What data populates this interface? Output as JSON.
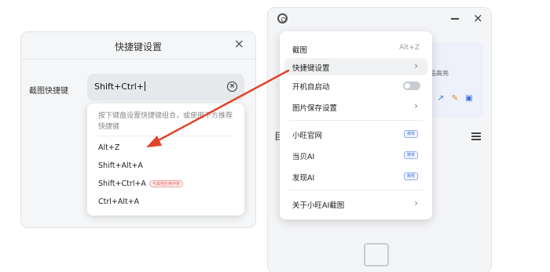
{
  "dialog": {
    "title": "快捷键设置",
    "close_glyph": "×",
    "field_label": "截图快捷键",
    "input_value": "Shift+Ctrl+",
    "dropdown": {
      "hint": "按下键盘设置快捷键组合，或使用下方推荐快捷键",
      "options": [
        {
          "label": "Alt+Z",
          "tag": ""
        },
        {
          "label": "Shift+Alt+A",
          "tag": ""
        },
        {
          "label": "Shift+Ctrl+A",
          "tag": "与其他应用冲突"
        },
        {
          "label": "Ctrl+Alt+A",
          "tag": ""
        }
      ]
    }
  },
  "panel": {
    "close_glyph": "×",
    "background_text": "品高亮",
    "background_left_glyph": "目"
  },
  "menu": {
    "items": [
      {
        "label": "截图",
        "shortcut": "Alt+Z"
      },
      {
        "label": "快捷键设置",
        "chevron": "›"
      },
      {
        "label": "开机自启动",
        "toggle_on": false
      },
      {
        "label": "图片保存设置",
        "chevron": "›"
      },
      {
        "label": "小旺官网",
        "badge": "推荐"
      },
      {
        "label": "当贝AI",
        "badge": "推荐"
      },
      {
        "label": "发现AI",
        "badge": "推荐"
      },
      {
        "label": "关于小旺AI截图",
        "chevron": "›"
      }
    ]
  },
  "colors": {
    "arrow": "#e0442a",
    "badge": "#4f7be8",
    "conflict_tag": "#e05050"
  }
}
